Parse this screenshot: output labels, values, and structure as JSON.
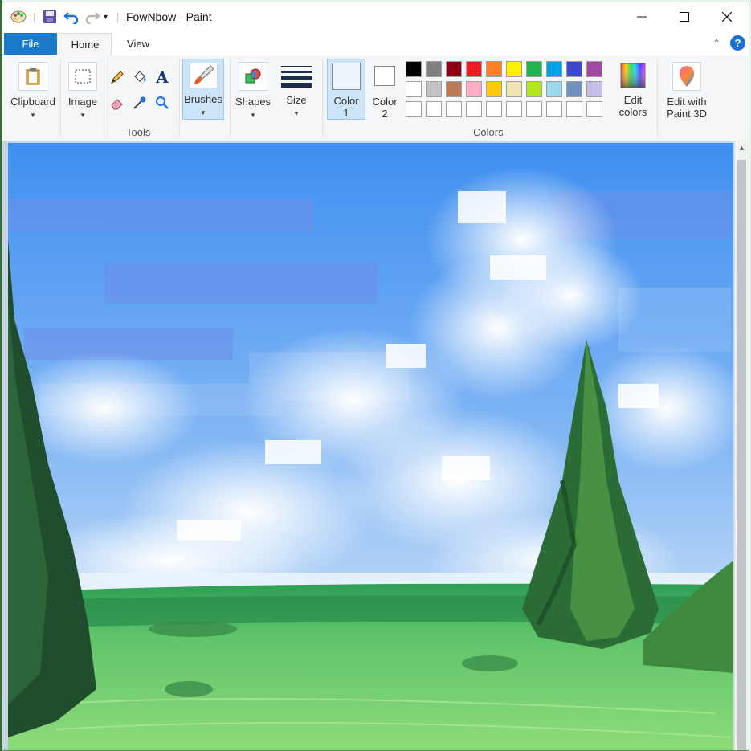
{
  "window": {
    "title": "FowNbow - Paint"
  },
  "tabs": {
    "file": "File",
    "home": "Home",
    "view": "View"
  },
  "ribbon": {
    "clipboard": "Clipboard",
    "image": "Image",
    "tools_group": "Tools",
    "brushes": "Brushes",
    "shapes": "Shapes",
    "size": "Size",
    "color1_line1": "Color",
    "color1_line2": "1",
    "color2_line1": "Color",
    "color2_line2": "2",
    "edit_colors_line1": "Edit",
    "edit_colors_line2": "colors",
    "paint3d_line1": "Edit with",
    "paint3d_line2": "Paint 3D",
    "colors_group": "Colors",
    "palette_row1": [
      "#000000",
      "#7f7f7f",
      "#880015",
      "#ed1c24",
      "#ff7f27",
      "#fff200",
      "#22b14c",
      "#00a2e8",
      "#3f48cc",
      "#a349a4"
    ],
    "palette_row2": [
      "#ffffff",
      "#c3c3c3",
      "#b97a57",
      "#ffaec9",
      "#ffc90e",
      "#efe4b0",
      "#b5e61d",
      "#99d9ea",
      "#7092be",
      "#c8bfe7"
    ],
    "palette_row3": [
      "#ffffff",
      "#ffffff",
      "#ffffff",
      "#ffffff",
      "#ffffff",
      "#ffffff",
      "#ffffff",
      "#ffffff",
      "#ffffff",
      "#ffffff"
    ],
    "color1_value": "#eef4fb",
    "color2_value": "#ffffff"
  },
  "icons": [
    "paint-app-icon",
    "save-icon",
    "undo-icon",
    "redo-icon",
    "customize-quick-access-icon",
    "minimize-icon",
    "maximize-icon",
    "close-icon",
    "collapse-ribbon-icon",
    "help-icon",
    "clipboard-icon",
    "select-icon",
    "pencil-icon",
    "fill-icon",
    "text-icon",
    "eraser-icon",
    "color-picker-icon",
    "magnifier-icon",
    "brush-icon",
    "shapes-icon",
    "size-icon",
    "edit-colors-icon",
    "paint3d-icon"
  ]
}
